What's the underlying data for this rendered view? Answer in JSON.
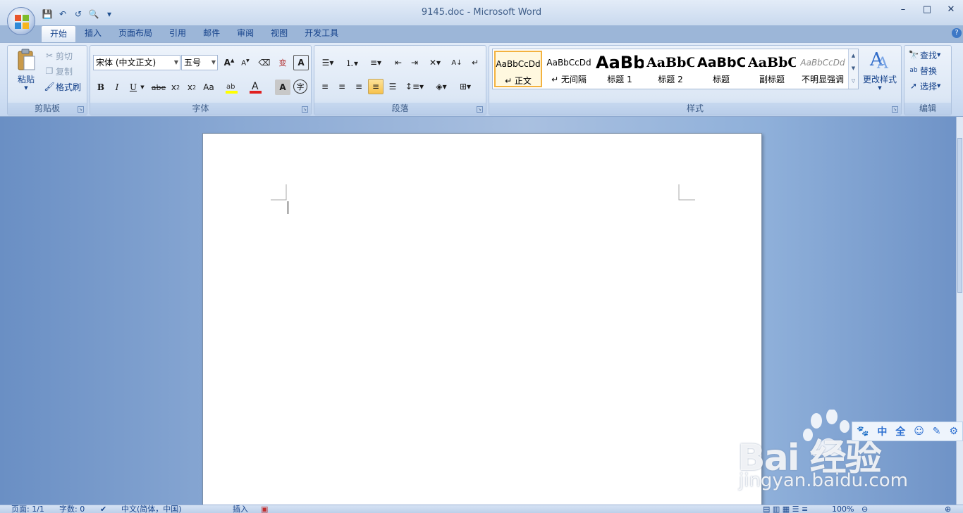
{
  "window": {
    "title": "9145.doc - Microsoft Word"
  },
  "quick_access": [
    {
      "name": "save-icon",
      "glyph": "💾"
    },
    {
      "name": "undo-icon",
      "glyph": "↶"
    },
    {
      "name": "redo-icon",
      "glyph": "↺"
    },
    {
      "name": "print-preview-icon",
      "glyph": "🔍"
    },
    {
      "name": "customize-qat-icon",
      "glyph": "▾"
    }
  ],
  "window_controls": {
    "minimize": "–",
    "maximize": "□",
    "close": "✕"
  },
  "tabs": [
    "开始",
    "插入",
    "页面布局",
    "引用",
    "邮件",
    "审阅",
    "视图",
    "开发工具"
  ],
  "ribbon": {
    "clipboard": {
      "label": "剪贴板",
      "paste": "粘贴",
      "cut": "剪切",
      "copy": "复制",
      "format_painter": "格式刷"
    },
    "font": {
      "label": "字体",
      "font_name": "宋体 (中文正文)",
      "font_size": "五号",
      "font_color": "#e02020",
      "highlight_color": "#ffff00"
    },
    "paragraph": {
      "label": "段落"
    },
    "styles": {
      "label": "样式",
      "change_styles": "更改样式",
      "items": [
        {
          "sample": "AaBbCcDd",
          "name": "↵ 正文"
        },
        {
          "sample": "AaBbCcDd",
          "name": "↵ 无间隔"
        },
        {
          "sample": "AaBb",
          "name": "标题 1"
        },
        {
          "sample": "AaBbC",
          "name": "标题 2"
        },
        {
          "sample": "AaBbC",
          "name": "标题"
        },
        {
          "sample": "AaBbC",
          "name": "副标题"
        },
        {
          "sample": "AaBbCcDd",
          "name": "不明显强调"
        }
      ]
    },
    "editing": {
      "label": "编辑",
      "find": "查找",
      "replace": "替换",
      "select": "选择"
    }
  },
  "statusbar": {
    "page": "页面: 1/1",
    "words": "字数: 0",
    "language": "中文(简体，中国)",
    "mode": "插入",
    "zoom": "100%"
  },
  "ime_toolbar": {
    "paw": "🐾",
    "lang": "中",
    "width": "全",
    "emoji": "☺",
    "pen": "✎",
    "settings": "⚙"
  },
  "watermark": {
    "logo": "Bai  经验",
    "url": "jingyan.baidu.com"
  }
}
